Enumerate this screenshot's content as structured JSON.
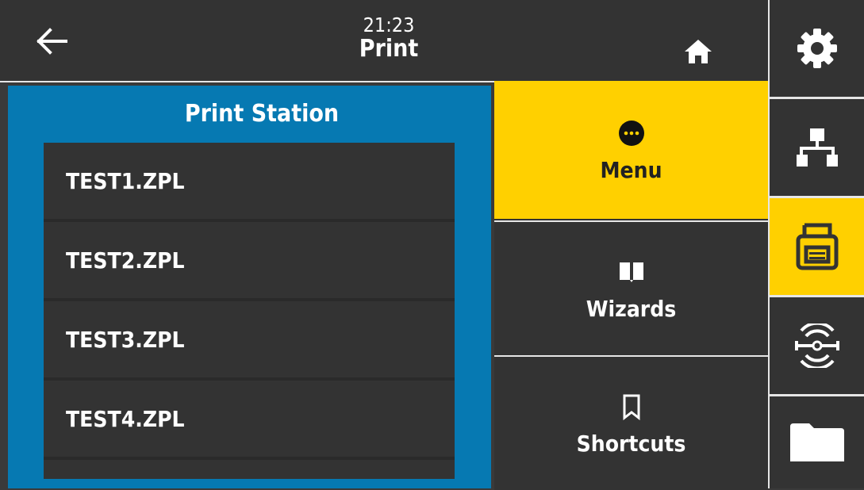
{
  "header": {
    "time": "21:23",
    "title": "Print"
  },
  "station": {
    "title": "Print Station",
    "files": [
      "TEST1.ZPL",
      "TEST2.ZPL",
      "TEST3.ZPL",
      "TEST4.ZPL"
    ]
  },
  "menu": {
    "menu_label": "Menu",
    "wizards_label": "Wizards",
    "shortcuts_label": "Shortcuts"
  },
  "sidebar": {
    "items": [
      {
        "icon": "gear-icon"
      },
      {
        "icon": "network-icon"
      },
      {
        "icon": "printer-icon",
        "active": true
      },
      {
        "icon": "rfid-icon"
      },
      {
        "icon": "folder-icon"
      }
    ]
  },
  "colors": {
    "accent": "#ffd000",
    "station_bg": "#0679b2",
    "panel_bg": "#333333"
  }
}
